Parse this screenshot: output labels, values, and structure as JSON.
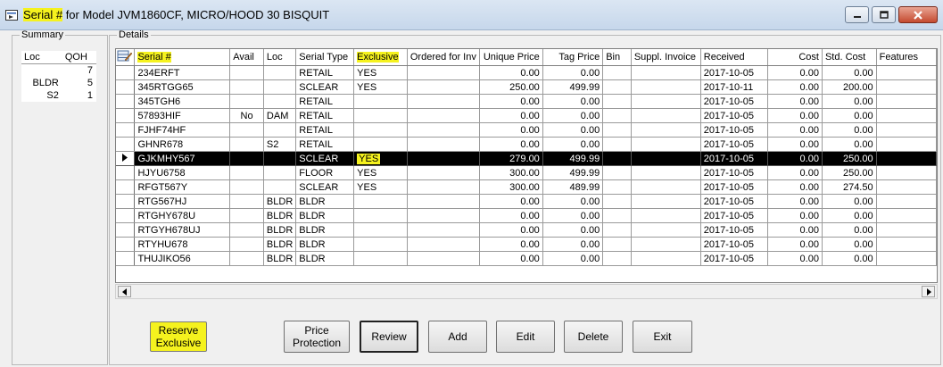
{
  "window": {
    "title_highlight": "Serial #",
    "title_rest": " for Model JVM1860CF, MICRO/HOOD 30 BISQUIT"
  },
  "summary": {
    "legend": "Summary",
    "columns": [
      "Loc",
      "QOH"
    ],
    "rows": [
      {
        "loc": "",
        "qoh": "7"
      },
      {
        "loc": "BLDR",
        "qoh": "5"
      },
      {
        "loc": "S2",
        "qoh": "1"
      }
    ]
  },
  "details": {
    "legend": "Details",
    "columns": [
      "Serial #",
      "Avail",
      "Loc",
      "Serial Type",
      "Exclusive",
      "Ordered for Inv",
      "Unique Price",
      "Tag Price",
      "Bin",
      "Suppl. Invoice",
      "Received",
      "Cost",
      "Std. Cost",
      "Features"
    ],
    "rows": [
      {
        "serial": "234ERFT",
        "avail": "",
        "loc": "",
        "type": "RETAIL",
        "exclusive": "YES",
        "ordered": "",
        "unique": "0.00",
        "tag": "0.00",
        "bin": "",
        "suppl": "",
        "received": "2017-10-05",
        "cost": "0.00",
        "std": "0.00",
        "features": ""
      },
      {
        "serial": "345RTGG65",
        "avail": "",
        "loc": "",
        "type": "SCLEAR",
        "exclusive": "YES",
        "ordered": "",
        "unique": "250.00",
        "tag": "499.99",
        "bin": "",
        "suppl": "",
        "received": "2017-10-11",
        "cost": "0.00",
        "std": "200.00",
        "features": ""
      },
      {
        "serial": "345TGH6",
        "avail": "",
        "loc": "",
        "type": "RETAIL",
        "exclusive": "",
        "ordered": "",
        "unique": "0.00",
        "tag": "0.00",
        "bin": "",
        "suppl": "",
        "received": "2017-10-05",
        "cost": "0.00",
        "std": "0.00",
        "features": ""
      },
      {
        "serial": "57893HIF",
        "avail": "No",
        "loc": "DAM",
        "type": "RETAIL",
        "exclusive": "",
        "ordered": "",
        "unique": "0.00",
        "tag": "0.00",
        "bin": "",
        "suppl": "",
        "received": "2017-10-05",
        "cost": "0.00",
        "std": "0.00",
        "features": ""
      },
      {
        "serial": "FJHF74HF",
        "avail": "",
        "loc": "",
        "type": "RETAIL",
        "exclusive": "",
        "ordered": "",
        "unique": "0.00",
        "tag": "0.00",
        "bin": "",
        "suppl": "",
        "received": "2017-10-05",
        "cost": "0.00",
        "std": "0.00",
        "features": ""
      },
      {
        "serial": "GHNR678",
        "avail": "",
        "loc": "S2",
        "type": "RETAIL",
        "exclusive": "",
        "ordered": "",
        "unique": "0.00",
        "tag": "0.00",
        "bin": "",
        "suppl": "",
        "received": "2017-10-05",
        "cost": "0.00",
        "std": "0.00",
        "features": ""
      },
      {
        "serial": "GJKMHY567",
        "avail": "",
        "loc": "",
        "type": "SCLEAR",
        "exclusive": "YES",
        "ordered": "",
        "unique": "279.00",
        "tag": "499.99",
        "bin": "",
        "suppl": "",
        "received": "2017-10-05",
        "cost": "0.00",
        "std": "250.00",
        "features": "",
        "selected": true
      },
      {
        "serial": "HJYU6758",
        "avail": "",
        "loc": "",
        "type": "FLOOR",
        "exclusive": "YES",
        "ordered": "",
        "unique": "300.00",
        "tag": "499.99",
        "bin": "",
        "suppl": "",
        "received": "2017-10-05",
        "cost": "0.00",
        "std": "250.00",
        "features": ""
      },
      {
        "serial": "RFGT567Y",
        "avail": "",
        "loc": "",
        "type": "SCLEAR",
        "exclusive": "YES",
        "ordered": "",
        "unique": "300.00",
        "tag": "489.99",
        "bin": "",
        "suppl": "",
        "received": "2017-10-05",
        "cost": "0.00",
        "std": "274.50",
        "features": ""
      },
      {
        "serial": "RTG567HJ",
        "avail": "",
        "loc": "BLDR",
        "type": "BLDR",
        "exclusive": "",
        "ordered": "",
        "unique": "0.00",
        "tag": "0.00",
        "bin": "",
        "suppl": "",
        "received": "2017-10-05",
        "cost": "0.00",
        "std": "0.00",
        "features": ""
      },
      {
        "serial": "RTGHY678U",
        "avail": "",
        "loc": "BLDR",
        "type": "BLDR",
        "exclusive": "",
        "ordered": "",
        "unique": "0.00",
        "tag": "0.00",
        "bin": "",
        "suppl": "",
        "received": "2017-10-05",
        "cost": "0.00",
        "std": "0.00",
        "features": ""
      },
      {
        "serial": "RTGYH678UJ",
        "avail": "",
        "loc": "BLDR",
        "type": "BLDR",
        "exclusive": "",
        "ordered": "",
        "unique": "0.00",
        "tag": "0.00",
        "bin": "",
        "suppl": "",
        "received": "2017-10-05",
        "cost": "0.00",
        "std": "0.00",
        "features": ""
      },
      {
        "serial": "RTYHU678",
        "avail": "",
        "loc": "BLDR",
        "type": "BLDR",
        "exclusive": "",
        "ordered": "",
        "unique": "0.00",
        "tag": "0.00",
        "bin": "",
        "suppl": "",
        "received": "2017-10-05",
        "cost": "0.00",
        "std": "0.00",
        "features": ""
      },
      {
        "serial": "THUJIKO56",
        "avail": "",
        "loc": "BLDR",
        "type": "BLDR",
        "exclusive": "",
        "ordered": "",
        "unique": "0.00",
        "tag": "0.00",
        "bin": "",
        "suppl": "",
        "received": "2017-10-05",
        "cost": "0.00",
        "std": "0.00",
        "features": ""
      }
    ]
  },
  "buttons": {
    "reserve_line1": "Reserve",
    "reserve_line2": "Exclusive",
    "price_line1": "Price",
    "price_line2": "Protection",
    "review": "Review",
    "add": "Add",
    "edit": "Edit",
    "delete": "Delete",
    "exit": "Exit"
  },
  "colors": {
    "highlight": "#f5f21e",
    "selected_row": "#000000"
  },
  "icons": [
    "app-icon",
    "minimize-icon",
    "maximize-icon",
    "close-icon",
    "edit-grid-icon",
    "row-pointer-icon",
    "scroll-left-icon",
    "scroll-right-icon"
  ]
}
